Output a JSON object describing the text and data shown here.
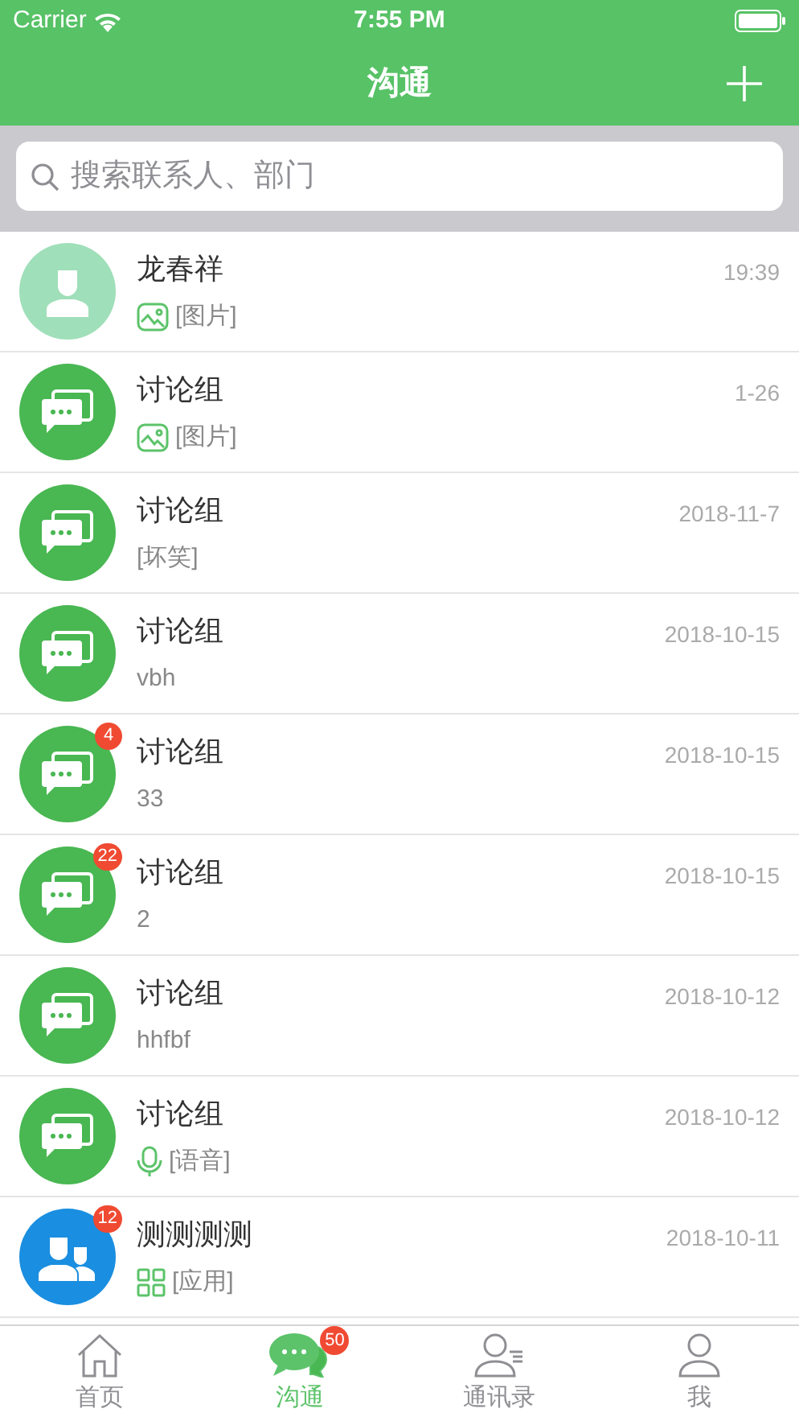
{
  "status_bar": {
    "carrier": "Carrier",
    "time": "7:55 PM"
  },
  "nav": {
    "title": "沟通"
  },
  "search": {
    "placeholder": "搜索联系人、部门"
  },
  "conversations": [
    {
      "avatar": {
        "kind": "person"
      },
      "name": "龙春祥",
      "preview": {
        "kind": "image",
        "text": "[图片]"
      },
      "time": "19:39"
    },
    {
      "avatar": {
        "kind": "group"
      },
      "name": "讨论组",
      "preview": {
        "kind": "image",
        "text": "[图片]"
      },
      "time": "1-26"
    },
    {
      "avatar": {
        "kind": "group"
      },
      "name": "讨论组",
      "preview": {
        "kind": "text",
        "text": "[坏笑]"
      },
      "time": "2018-11-7"
    },
    {
      "avatar": {
        "kind": "group"
      },
      "name": "讨论组",
      "preview": {
        "kind": "text",
        "text": "vbh"
      },
      "time": "2018-10-15"
    },
    {
      "avatar": {
        "kind": "group"
      },
      "name": "讨论组",
      "preview": {
        "kind": "text",
        "text": "33"
      },
      "time": "2018-10-15",
      "badge": "4"
    },
    {
      "avatar": {
        "kind": "group"
      },
      "name": "讨论组",
      "preview": {
        "kind": "text",
        "text": "2"
      },
      "time": "2018-10-15",
      "badge": "22"
    },
    {
      "avatar": {
        "kind": "group"
      },
      "name": "讨论组",
      "preview": {
        "kind": "text",
        "text": "hhfbf"
      },
      "time": "2018-10-12"
    },
    {
      "avatar": {
        "kind": "group"
      },
      "name": "讨论组",
      "preview": {
        "kind": "voice",
        "text": "[语音]"
      },
      "time": "2018-10-12"
    },
    {
      "avatar": {
        "kind": "team"
      },
      "name": "测测测测",
      "preview": {
        "kind": "app",
        "text": "[应用]"
      },
      "time": "2018-10-11",
      "badge": "12"
    }
  ],
  "tab_bar": [
    {
      "kind": "home",
      "label": "首页",
      "selected": false
    },
    {
      "kind": "chat",
      "label": "沟通",
      "selected": true,
      "badge": "50"
    },
    {
      "kind": "contacts",
      "label": "通讯录",
      "selected": false
    },
    {
      "kind": "me",
      "label": "我",
      "selected": false
    }
  ]
}
